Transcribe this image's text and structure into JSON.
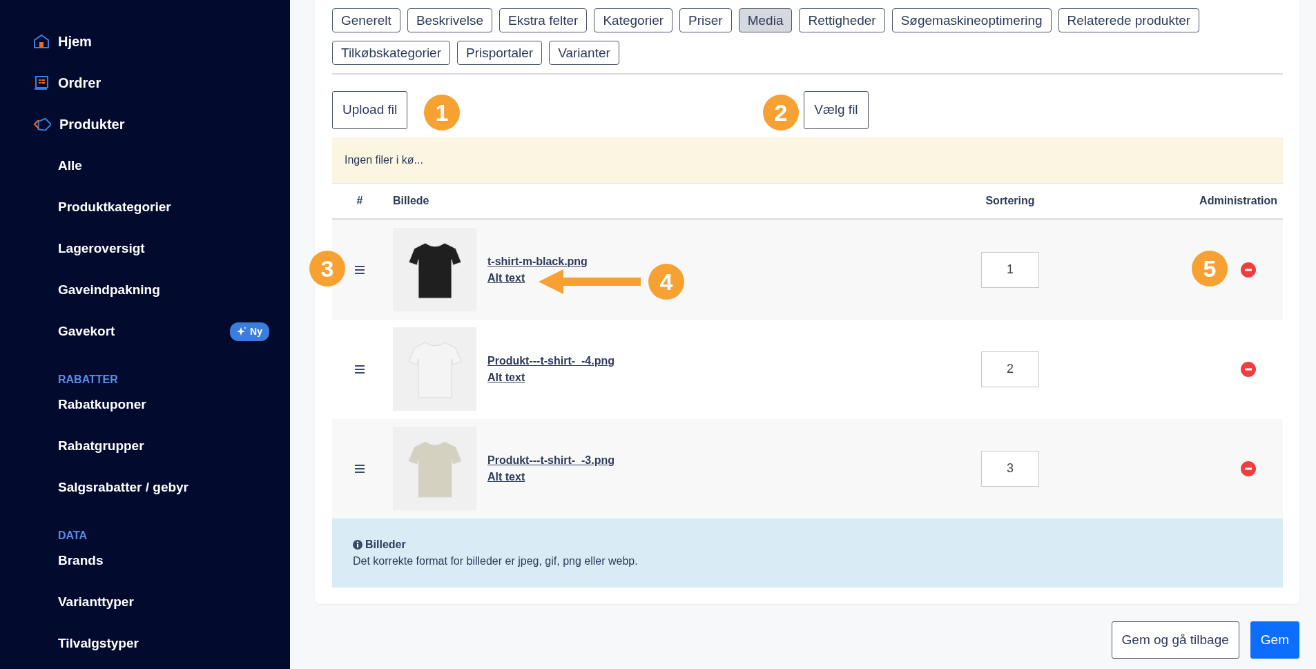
{
  "sidebar": {
    "items": [
      {
        "kind": "main",
        "label": "Hjem"
      },
      {
        "kind": "main",
        "label": "Ordrer"
      },
      {
        "kind": "main",
        "label": "Produkter"
      },
      {
        "kind": "sub",
        "label": "Alle"
      },
      {
        "kind": "sub",
        "label": "Produktkategorier"
      },
      {
        "kind": "sub",
        "label": "Lageroversigt"
      },
      {
        "kind": "sub",
        "label": "Gaveindpakning"
      },
      {
        "kind": "sub",
        "label": "Gavekort",
        "badge": "Ny"
      },
      {
        "kind": "section",
        "label": "RABATTER"
      },
      {
        "kind": "sub",
        "label": "Rabatkuponer"
      },
      {
        "kind": "sub",
        "label": "Rabatgrupper"
      },
      {
        "kind": "sub",
        "label": "Salgsrabatter / gebyr"
      },
      {
        "kind": "section",
        "label": "DATA"
      },
      {
        "kind": "sub",
        "label": "Brands"
      },
      {
        "kind": "sub",
        "label": "Varianttyper"
      },
      {
        "kind": "sub",
        "label": "Tilvalgstyper"
      }
    ]
  },
  "tabs": [
    {
      "label": "Generelt",
      "selected": false
    },
    {
      "label": "Beskrivelse",
      "selected": false
    },
    {
      "label": "Ekstra felter",
      "selected": false
    },
    {
      "label": "Kategorier",
      "selected": false
    },
    {
      "label": "Priser",
      "selected": false
    },
    {
      "label": "Media",
      "selected": true
    },
    {
      "label": "Rettigheder",
      "selected": false
    },
    {
      "label": "Søgemaskineoptimering",
      "selected": false
    },
    {
      "label": "Relaterede produkter",
      "selected": false
    },
    {
      "label": "Tilkøbskategorier",
      "selected": false
    },
    {
      "label": "Prisportaler",
      "selected": false
    },
    {
      "label": "Varianter",
      "selected": false
    }
  ],
  "upload_button": "Upload fil",
  "choose_button": "Vælg fil",
  "queue_message": "Ingen filer i kø...",
  "table": {
    "columns": [
      "#",
      "Billede",
      "Sortering",
      "Administration"
    ],
    "rows": [
      {
        "filename": "t-shirt-m-black.png",
        "alt_link": "Alt text",
        "sort": "1",
        "color": "#1f1f1f"
      },
      {
        "filename": "Produkt---t-shirt-_-4.png",
        "alt_link": "Alt text",
        "sort": "2",
        "color": "#f4f4f4"
      },
      {
        "filename": "Produkt---t-shirt-_-3.png",
        "alt_link": "Alt text",
        "sort": "3",
        "color": "#d4d1c0"
      }
    ]
  },
  "info": {
    "title": "Billeder",
    "text": "Det korrekte format for billeder er jpeg, gif, png eller webp."
  },
  "footer_buttons": [
    {
      "label": "Gem og gå tilbage",
      "kind": "secondary"
    },
    {
      "label": "Gem",
      "kind": "primary"
    }
  ],
  "callouts": [
    {
      "number": "1"
    },
    {
      "number": "2"
    },
    {
      "number": "3"
    },
    {
      "number": "4",
      "arrow": true
    },
    {
      "number": "5"
    }
  ]
}
